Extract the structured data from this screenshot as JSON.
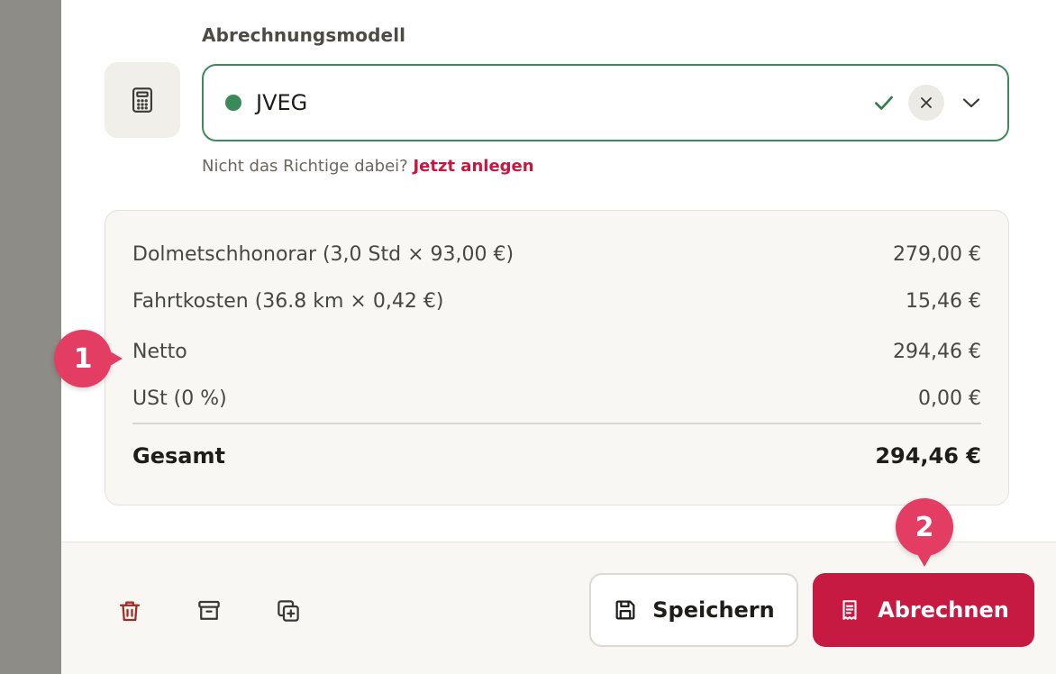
{
  "form": {
    "field_label": "Abrechnungsmodell",
    "selected_value": "JVEG",
    "status_color": "#3a8a59",
    "hint_text": "Nicht das Richtige dabei?",
    "hint_link": "Jetzt anlegen"
  },
  "summary": {
    "rows": [
      {
        "label": "Dolmetschhonorar (3,0 Std × 93,00 €)",
        "value": "279,00 €"
      },
      {
        "label": "Fahrtkosten (36.8 km × 0,42 €)",
        "value": "15,46 €"
      },
      {
        "label": "Netto",
        "value": "294,46 €"
      },
      {
        "label": "USt (0 %)",
        "value": "0,00 €"
      }
    ],
    "total": {
      "label": "Gesamt",
      "value": "294,46 €"
    }
  },
  "footer": {
    "icons": [
      "trash-icon",
      "archive-icon",
      "duplicate-icon"
    ],
    "save_label": "Speichern",
    "bill_label": "Abrechnen"
  },
  "annotations": {
    "badge_1": "1",
    "badge_2": "2"
  },
  "colors": {
    "accent": "#c61a42",
    "success": "#3c8a58",
    "badge": "#e33d64"
  }
}
